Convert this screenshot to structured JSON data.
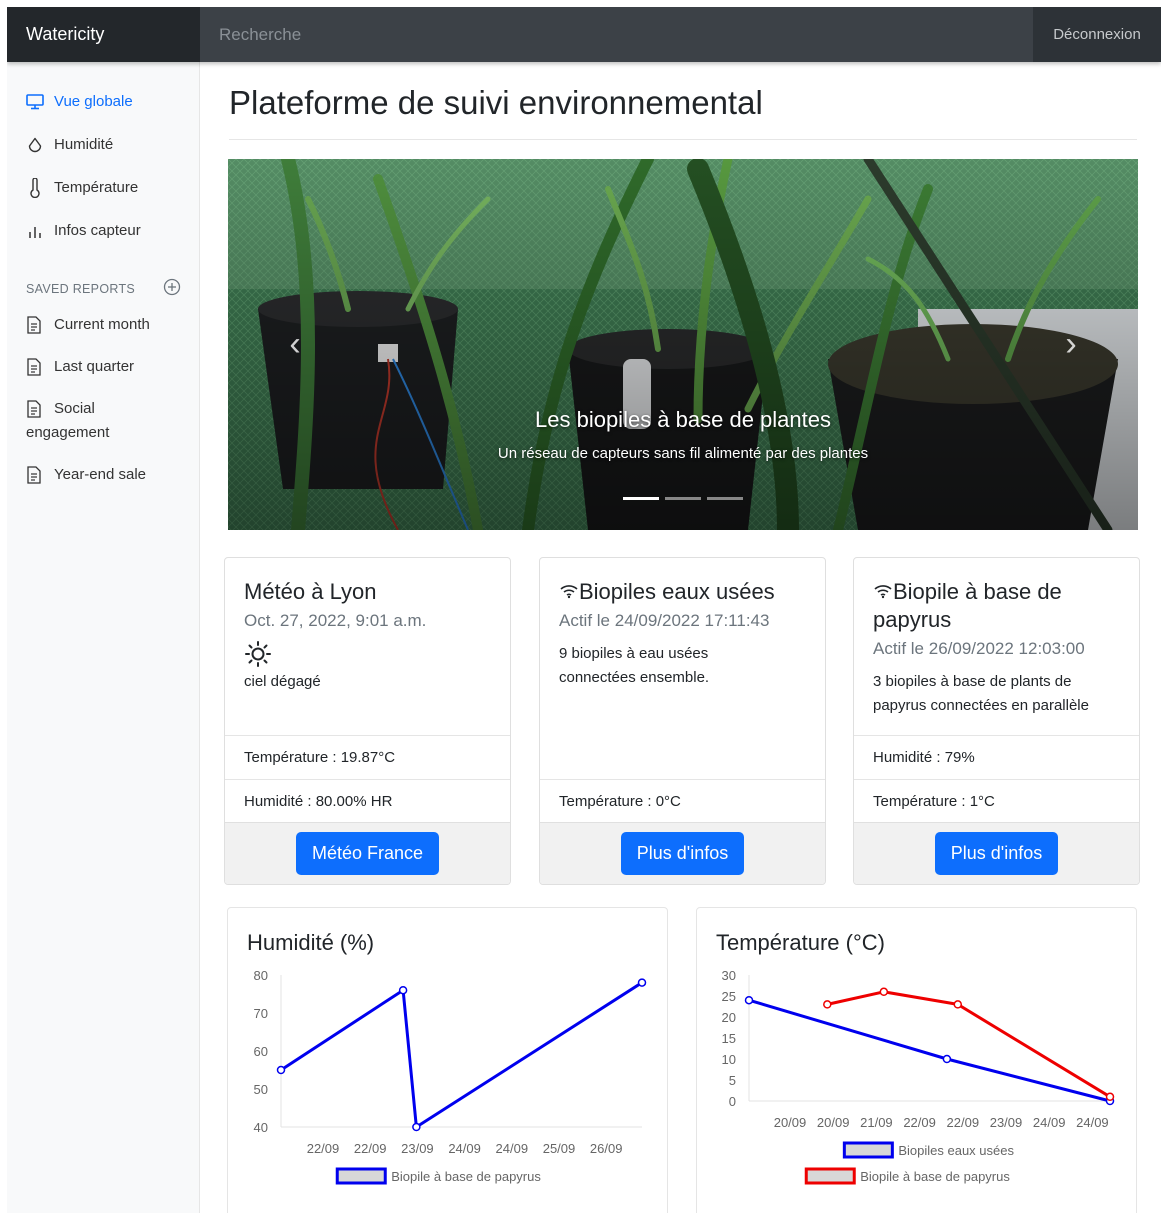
{
  "navbar": {
    "brand": "Watericity",
    "search_placeholder": "Recherche",
    "logout": "Déconnexion"
  },
  "sidebar": {
    "items": [
      {
        "label": "Vue globale",
        "icon": "monitor-icon",
        "active": true
      },
      {
        "label": "Humidité",
        "icon": "droplet-icon"
      },
      {
        "label": "Température",
        "icon": "thermometer-icon"
      },
      {
        "label": "Infos capteur",
        "icon": "bar-chart-icon"
      }
    ],
    "saved_reports_heading": "SAVED REPORTS",
    "reports": [
      {
        "label": "Current month"
      },
      {
        "label": "Last quarter"
      },
      {
        "label": "Social engagement"
      },
      {
        "label": "Year-end sale"
      }
    ]
  },
  "main": {
    "title": "Plateforme de suivi environnemental",
    "carousel": {
      "caption_title": "Les biopiles à base de plantes",
      "caption_text": "Un réseau de capteurs sans fil alimenté par des plantes",
      "slide_count": 3,
      "active_slide": 1
    },
    "cards": [
      {
        "title": "Météo à Lyon",
        "subtitle": "Oct. 27, 2022, 9:01 a.m.",
        "icon": "sun-icon",
        "text": "ciel dégagé",
        "rows": [
          "Température : 19.87°C",
          "Humidité : 80.00% HR"
        ],
        "button": "Météo France"
      },
      {
        "title": "Biopiles eaux usées",
        "subtitle": "Actif le 24/09/2022 17:11:43",
        "icon": "wifi-icon",
        "text": "9 biopiles à eau usées connectées ensemble.",
        "rows": [
          "Température : 0°C"
        ],
        "button": "Plus d'infos"
      },
      {
        "title": "Biopile à base de papyrus",
        "subtitle": "Actif le 26/09/2022 12:03:00",
        "icon": "wifi-icon",
        "text": "3 biopiles à base de plants de papyrus connectées en parallèle",
        "rows": [
          "Humidité : 79%",
          "Température : 1°C"
        ],
        "button": "Plus d'infos"
      }
    ]
  },
  "chart_data": [
    {
      "type": "line",
      "title": "Humidité (%)",
      "categories": [
        "22/09",
        "22/09",
        "23/09",
        "24/09",
        "24/09",
        "25/09",
        "26/09"
      ],
      "ylim": [
        40,
        80
      ],
      "yticks": [
        80,
        70,
        60,
        50,
        40
      ],
      "series": [
        {
          "name": "Biopile à base de papyrus",
          "color": "#0000ee",
          "points": [
            [
              0,
              55
            ],
            [
              2.3,
              76
            ],
            [
              2.55,
              40
            ],
            [
              6.8,
              78
            ]
          ]
        }
      ],
      "legend": "bottom"
    },
    {
      "type": "line",
      "title": "Température (°C)",
      "categories": [
        "20/09",
        "20/09",
        "21/09",
        "22/09",
        "22/09",
        "23/09",
        "24/09",
        "24/09"
      ],
      "ylim": [
        0,
        30
      ],
      "yticks": [
        30,
        25,
        20,
        15,
        10,
        5,
        0
      ],
      "series": [
        {
          "name": "Biopiles eaux usées",
          "color": "#0000ee",
          "points": [
            [
              0,
              24
            ],
            [
              4.55,
              10
            ],
            [
              8.3,
              0
            ]
          ]
        },
        {
          "name": "Biopile à base de papyrus",
          "color": "#ee0000",
          "points": [
            [
              1.8,
              23
            ],
            [
              3.1,
              26
            ],
            [
              4.8,
              23
            ],
            [
              8.3,
              1
            ]
          ]
        }
      ],
      "legend": "bottom"
    }
  ]
}
